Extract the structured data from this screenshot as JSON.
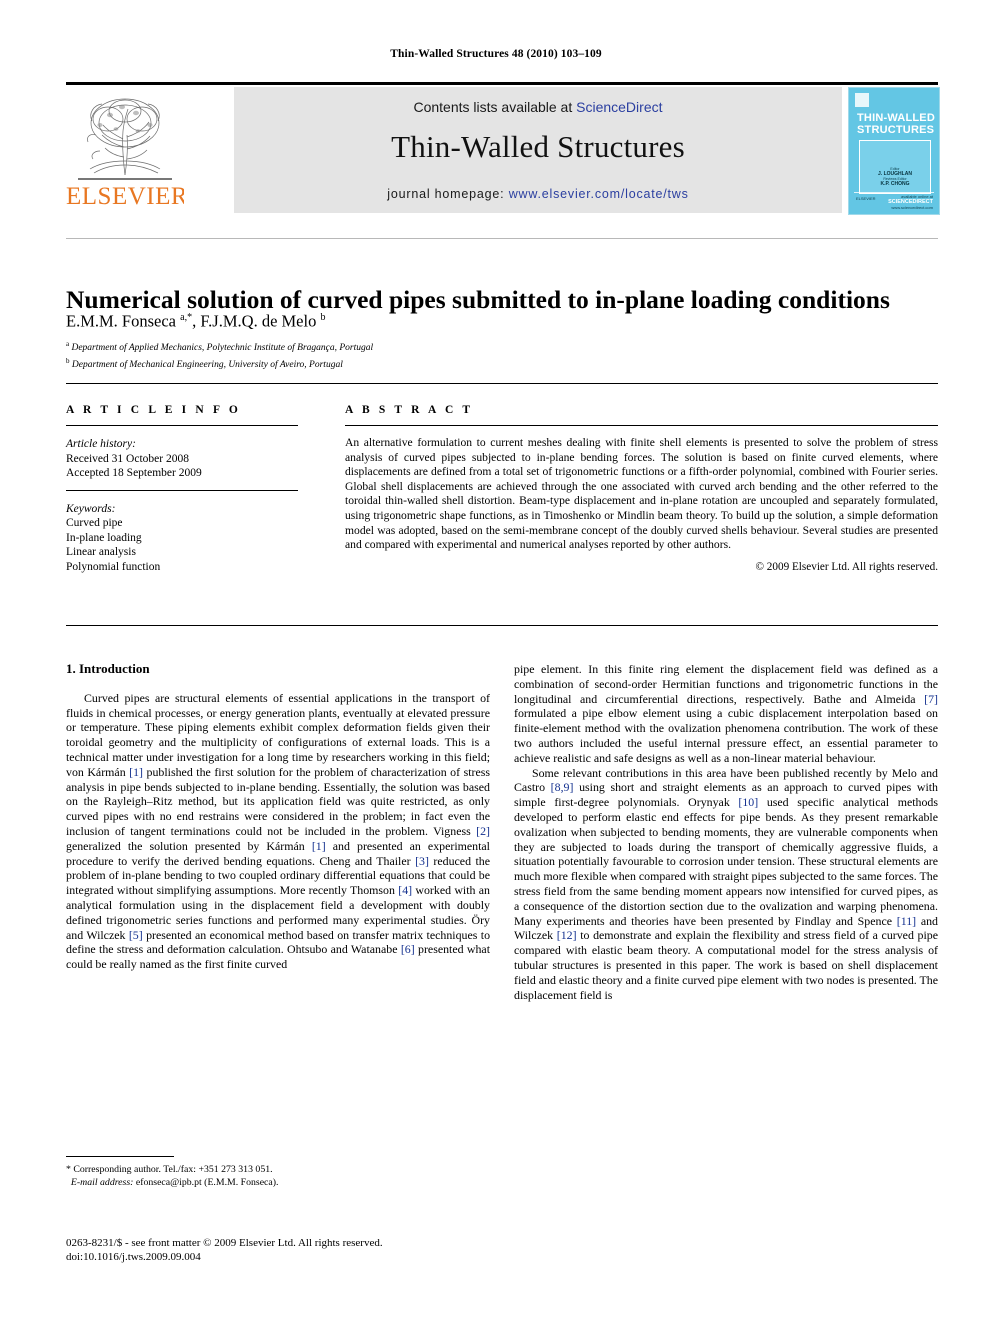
{
  "running_head": "Thin-Walled Structures 48 (2010) 103–109",
  "masthead": {
    "contents_prefix": "Contents lists available at ",
    "contents_link": "ScienceDirect",
    "journal_title": "Thin-Walled Structures",
    "homepage_prefix": "journal homepage: ",
    "homepage_url": "www.elsevier.com/locate/tws",
    "publisher_logo_text": "ELSEVIER",
    "publisher_logo_color": "#E87722",
    "link_color": "#2b3fa0",
    "band_color": "#e4e4e4",
    "cover": {
      "title_line1": "THIN-WALLED",
      "title_line2": "STRUCTURES",
      "editor_label": "Editor",
      "editor_name": "J. LOUGHLAN",
      "assoc_label": "Reviews Editor",
      "assoc_name": "K.P. CHONG",
      "foot_left": "ELSEVIER",
      "foot_right_label": "available online at",
      "foot_right": "SCIENCEDIRECT",
      "foot_right_sub": "www.sciencedirect.com",
      "background_color": "#63c6e4"
    }
  },
  "article": {
    "title": "Numerical solution of curved pipes submitted to in-plane loading conditions",
    "authors_html": "E.M.M. Fonseca <sup>a,*</sup>, F.J.M.Q. de Melo <sup>b</sup>",
    "affiliation_a": "Department of Applied Mechanics, Polytechnic Institute of Bragança, Portugal",
    "affiliation_b": "Department of Mechanical Engineering, University of Aveiro, Portugal"
  },
  "article_info": {
    "heading": "A R T I C L E   I N F O",
    "history_label": "Article history:",
    "received": "Received 31 October 2008",
    "accepted": "Accepted 18 September 2009",
    "keywords_label": "Keywords:",
    "keywords": [
      "Curved pipe",
      "In-plane loading",
      "Linear analysis",
      "Polynomial function"
    ]
  },
  "abstract": {
    "heading": "A B S T R A C T",
    "text": "An alternative formulation to current meshes dealing with finite shell elements is presented to solve the problem of stress analysis of curved pipes subjected to in-plane bending forces. The solution is based on finite curved elements, where displacements are defined from a total set of trigonometric functions or a fifth-order polynomial, combined with Fourier series. Global shell displacements are achieved through the one associated with curved arch bending and the other referred to the toroidal thin-walled shell distortion. Beam-type displacement and in-plane rotation are uncoupled and separately formulated, using trigonometric shape functions, as in Timoshenko or Mindlin beam theory. To build up the solution, a simple deformation model was adopted, based on the semi-membrane concept of the doubly curved shells behaviour. Several studies are presented and compared with experimental and numerical analyses reported by other authors.",
    "copyright": "© 2009 Elsevier Ltd. All rights reserved."
  },
  "body": {
    "section_number_title": "1.  Introduction",
    "left_paragraph_1": "Curved pipes are structural elements of essential applications in the transport of fluids in chemical processes, or energy generation plants, eventually at elevated pressure or temperature. These piping elements exhibit complex deformation fields given their toroidal geometry and the multiplicity of configurations of external loads. This is a technical matter under investigation for a long time by researchers working in this field; von Kármán [1] published the first solution for the problem of characterization of stress analysis in pipe bends subjected to in-plane bending. Essentially, the solution was based on the Rayleigh–Ritz method, but its application field was quite restricted, as only curved pipes with no end restrains were considered in the problem; in fact even the inclusion of tangent terminations could not be included in the problem. Vigness [2] generalized the solution presented by Kármán [1] and presented an experimental procedure to verify the derived bending equations. Cheng and Thailer [3] reduced the problem of in-plane bending to two coupled ordinary differential equations that could be integrated without simplifying assumptions. More recently Thomson [4] worked with an analytical formulation using in the displacement field a development with doubly defined trigonometric series functions and performed many experimental studies. Öry and Wilczek [5] presented an economical method based on transfer matrix techniques to define the stress and deformation calculation. Ohtsubo and Watanabe [6] presented what could be really named as the first finite curved",
    "right_paragraph_1": "pipe element. In this finite ring element the displacement field was defined as a combination of second-order Hermitian functions and trigonometric functions in the longitudinal and circumferential directions, respectively. Bathe and Almeida [7] formulated a pipe elbow element using a cubic displacement interpolation based on finite-element method with the ovalization phenomena contribution. The work of these two authors included the useful internal pressure effect, an essential parameter to achieve realistic and safe designs as well as a non-linear material behaviour.",
    "right_paragraph_2": "Some relevant contributions in this area have been published recently by Melo and Castro [8,9] using short and straight elements as an approach to curved pipes with simple first-degree polynomials. Orynyak [10] used specific analytical methods developed to perform elastic end effects for pipe bends. As they present remarkable ovalization when subjected to bending moments, they are vulnerable components when they are subjected to loads during the transport of chemically aggressive fluids, a situation potentially favourable to corrosion under tension. These structural elements are much more flexible when compared with straight pipes subjected to the same forces. The stress field from the same bending moment appears now intensified for curved pipes, as a consequence of the distortion section due to the ovalization and warping phenomena. Many experiments and theories have been presented by Findlay and Spence [11] and Wilczek [12] to demonstrate and explain the flexibility and stress field of a curved pipe compared with elastic beam theory. A computational model for the stress analysis of tubular structures is presented in this paper. The work is based on shell displacement field and elastic theory and a finite curved pipe element with two nodes is presented. The displacement field is"
  },
  "footnote": {
    "corresponding": "* Corresponding author. Tel./fax: +351 273 313 051.",
    "email_label": "E-mail address:",
    "email": "efonseca@ipb.pt (E.M.M. Fonseca)."
  },
  "footer": {
    "line1": "0263-8231/$ - see front matter © 2009 Elsevier Ltd. All rights reserved.",
    "line2": "doi:10.1016/j.tws.2009.09.004"
  }
}
